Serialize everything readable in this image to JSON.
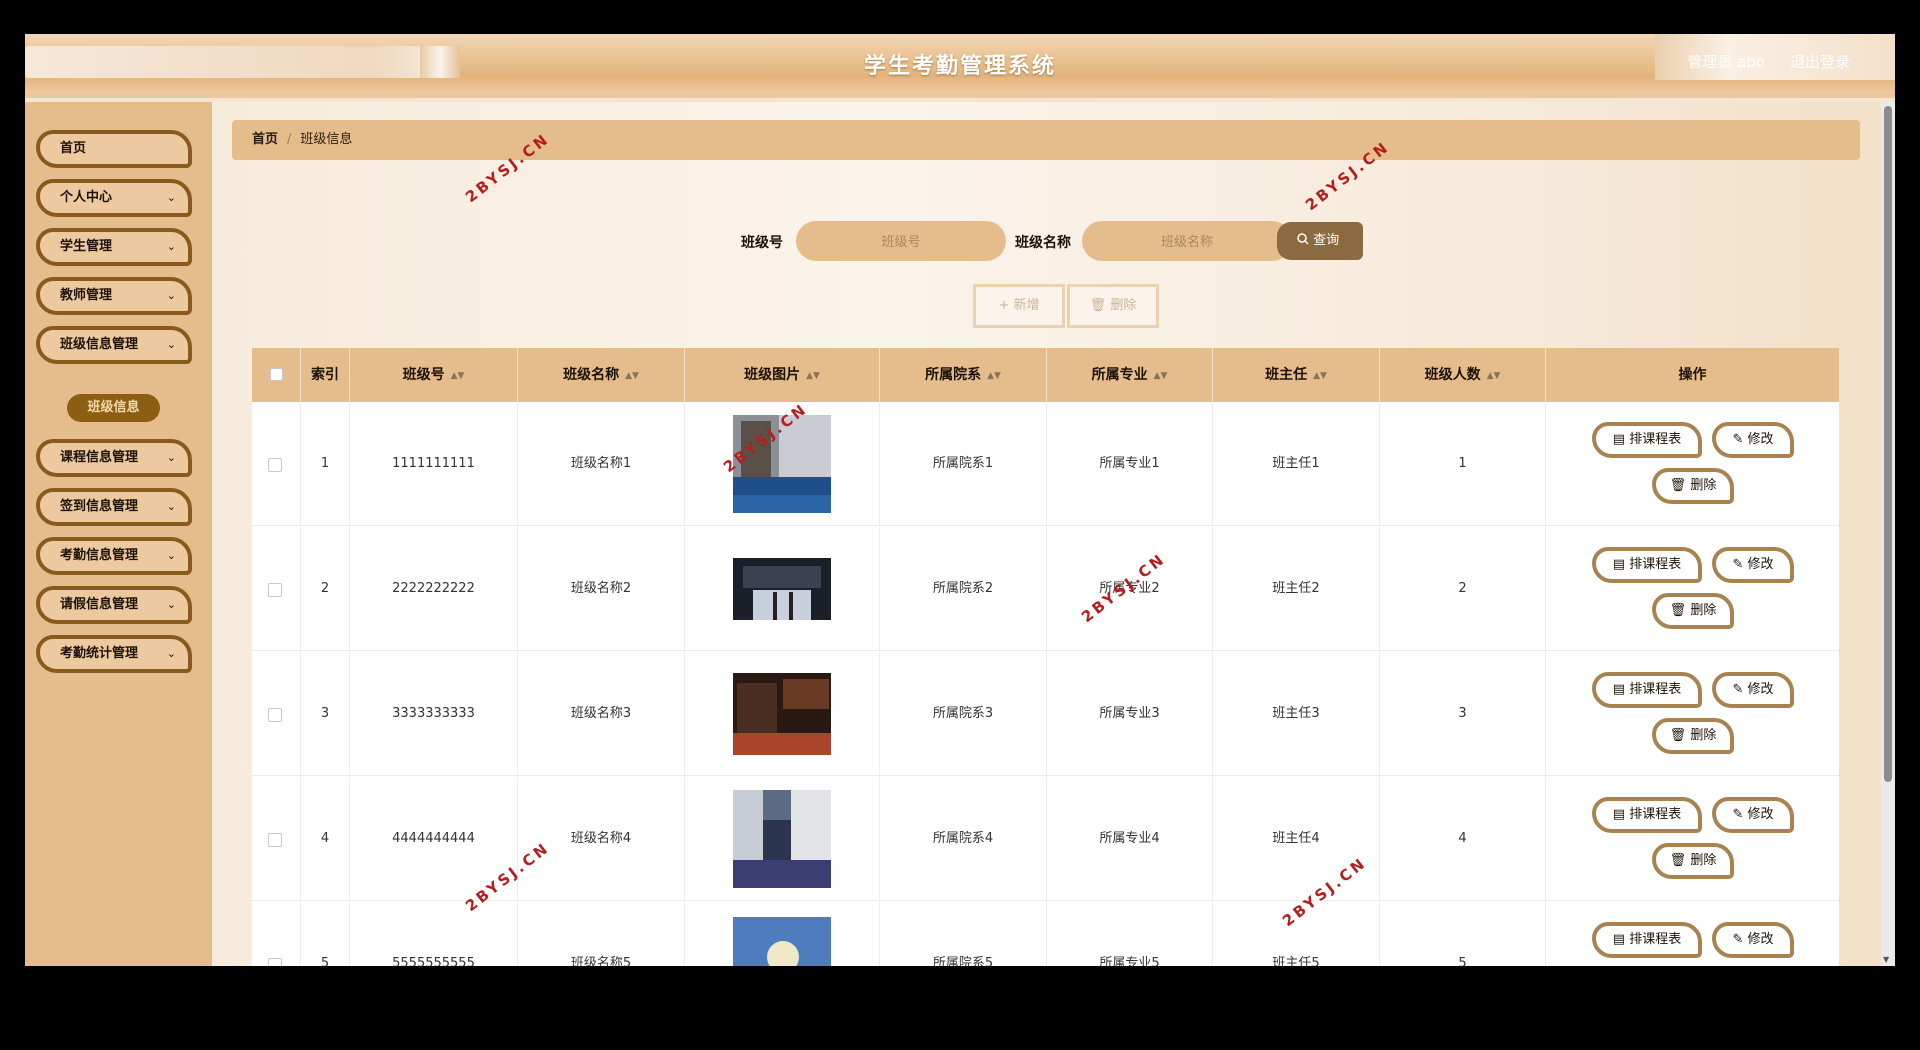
{
  "header": {
    "title": "学生考勤管理系统",
    "admin": "管理员 abo",
    "logout": "退出登录"
  },
  "sidebar": {
    "items": [
      {
        "label": "首页",
        "chevron": false
      },
      {
        "label": "个人中心",
        "chevron": true
      },
      {
        "label": "学生管理",
        "chevron": true
      },
      {
        "label": "教师管理",
        "chevron": true
      },
      {
        "label": "班级信息管理",
        "chevron": true
      },
      {
        "label": "课程信息管理",
        "chevron": true
      },
      {
        "label": "签到信息管理",
        "chevron": true
      },
      {
        "label": "考勤信息管理",
        "chevron": true
      },
      {
        "label": "请假信息管理",
        "chevron": true
      },
      {
        "label": "考勤统计管理",
        "chevron": true
      }
    ],
    "active_sub": "班级信息",
    "chevron_glyph": "⌄"
  },
  "breadcrumb": {
    "home": "首页",
    "sep": "/",
    "current": "班级信息"
  },
  "search": {
    "field1_label": "班级号",
    "field1_placeholder": "班级号",
    "field2_label": "班级名称",
    "field2_placeholder": "班级名称",
    "button": "查询"
  },
  "toolbar": {
    "add": "+ 新增",
    "delete": "删除"
  },
  "table": {
    "columns": [
      "索引",
      "班级号",
      "班级名称",
      "班级图片",
      "所属院系",
      "所属专业",
      "班主任",
      "班级人数",
      "操作"
    ],
    "rows": [
      {
        "index": "1",
        "class_no": "1111111111",
        "class_name": "班级名称1",
        "dept": "所属院系1",
        "major": "所属专业1",
        "teacher": "班主任1",
        "count": "1"
      },
      {
        "index": "2",
        "class_no": "2222222222",
        "class_name": "班级名称2",
        "dept": "所属院系2",
        "major": "所属专业2",
        "teacher": "班主任2",
        "count": "2"
      },
      {
        "index": "3",
        "class_no": "3333333333",
        "class_name": "班级名称3",
        "dept": "所属院系3",
        "major": "所属专业3",
        "teacher": "班主任3",
        "count": "3"
      },
      {
        "index": "4",
        "class_no": "4444444444",
        "class_name": "班级名称4",
        "dept": "所属院系4",
        "major": "所属专业4",
        "teacher": "班主任4",
        "count": "4"
      },
      {
        "index": "5",
        "class_no": "5555555555",
        "class_name": "班级名称5",
        "dept": "所属院系5",
        "major": "所属专业5",
        "teacher": "班主任5",
        "count": "5"
      }
    ],
    "actions": {
      "schedule": "排课程表",
      "edit": "修改",
      "delete": "删除"
    }
  },
  "watermark": "2BYSJ.CN",
  "colors": {
    "accent": "#e5bd8d",
    "dark_brown": "#8b5e13",
    "border_brown": "#a88350"
  }
}
